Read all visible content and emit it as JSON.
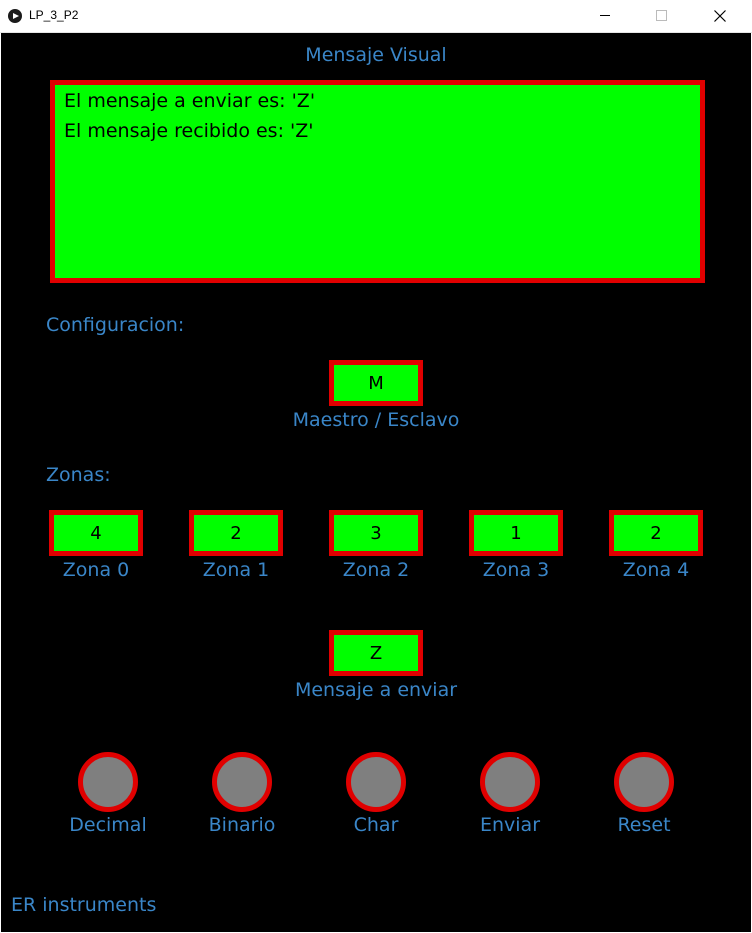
{
  "window": {
    "title": "LP_3_P2"
  },
  "display": {
    "heading": "Mensaje Visual",
    "lines": [
      "El mensaje a enviar es: 'Z'",
      "El mensaje recibido es: 'Z'"
    ]
  },
  "config": {
    "heading": "Configuracion:",
    "mode_value": "M",
    "mode_label": "Maestro / Esclavo"
  },
  "zones": {
    "heading": "Zonas:",
    "items": [
      {
        "value": "4",
        "label": "Zona 0"
      },
      {
        "value": "2",
        "label": "Zona 1"
      },
      {
        "value": "3",
        "label": "Zona 2"
      },
      {
        "value": "1",
        "label": "Zona 3"
      },
      {
        "value": "2",
        "label": "Zona 4"
      }
    ]
  },
  "message": {
    "value": "Z",
    "label": "Mensaje a enviar"
  },
  "buttons": [
    "Decimal",
    "Binario",
    "Char",
    "Enviar",
    "Reset"
  ],
  "footer": "ER instruments",
  "colors": {
    "background": "#000000",
    "text": "#3a86c8",
    "box_fill": "#00ff00",
    "border": "#e00000",
    "button_fill": "#7f7f7f"
  }
}
